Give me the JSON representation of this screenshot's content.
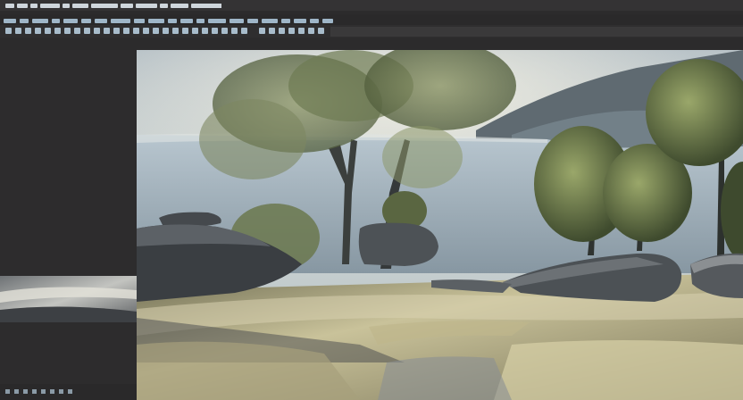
{
  "app": {
    "title": "",
    "menu": [
      "",
      "",
      "",
      "",
      "",
      "",
      "",
      ""
    ]
  },
  "viewport": {
    "label": "",
    "scene": "garden-rocks-trees"
  },
  "colors": {
    "background": "#2c2b2c",
    "panel": "#2d2c2d",
    "viewport_border": "#202020",
    "sky": "#c9d1d6",
    "foliage": "#6f7b52",
    "rock": "#4a4f55"
  }
}
